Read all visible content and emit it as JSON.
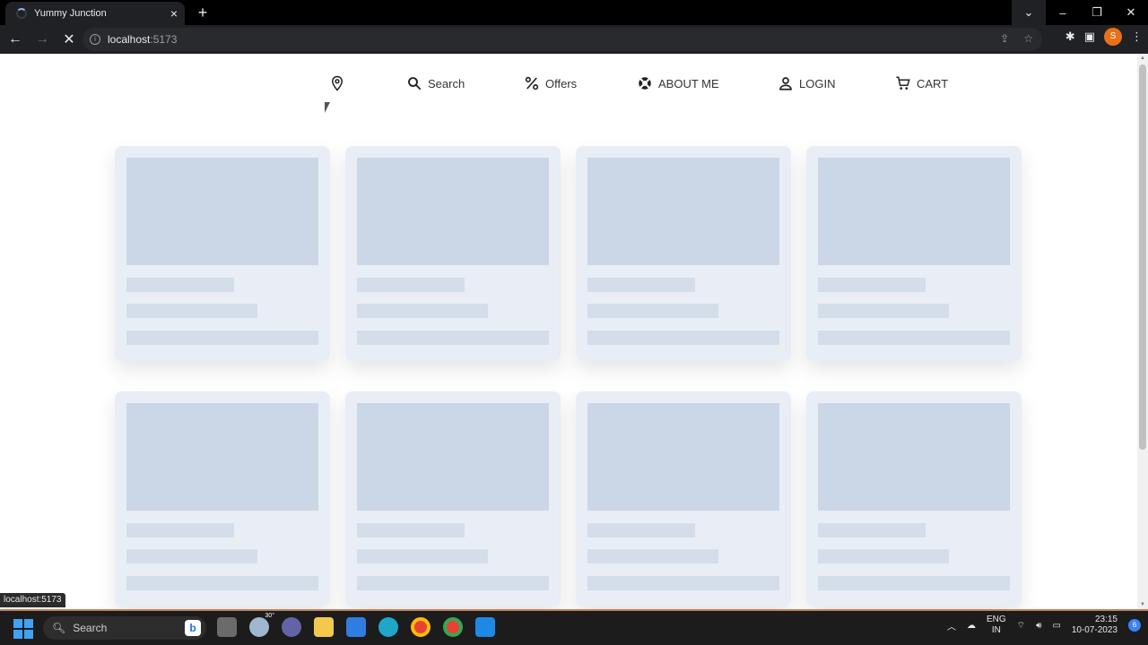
{
  "browser": {
    "tab_title": "Yummy Junction",
    "tab_close": "×",
    "new_tab": "+",
    "url_host": "localhost",
    "url_port": ":5173",
    "status_text": "localhost:5173",
    "profile_initial": "S"
  },
  "nav": {
    "search_label": "Search",
    "offers_label": "Offers",
    "about_label": "ABOUT ME",
    "login_label": "LOGIN",
    "cart_label": "CART"
  },
  "skeleton_cards": [
    1,
    2,
    3,
    4,
    5,
    6,
    7,
    8
  ],
  "taskbar": {
    "search_placeholder": "Search",
    "weather": "30°",
    "lang_top": "ENG",
    "lang_bottom": "IN",
    "time": "23:15",
    "date": "10-07-2023",
    "notif_count": "6"
  },
  "colors": {
    "skeleton_card": "#e9edf5",
    "skeleton_block": "#cbd7e6",
    "skeleton_line": "#d4deeb"
  }
}
